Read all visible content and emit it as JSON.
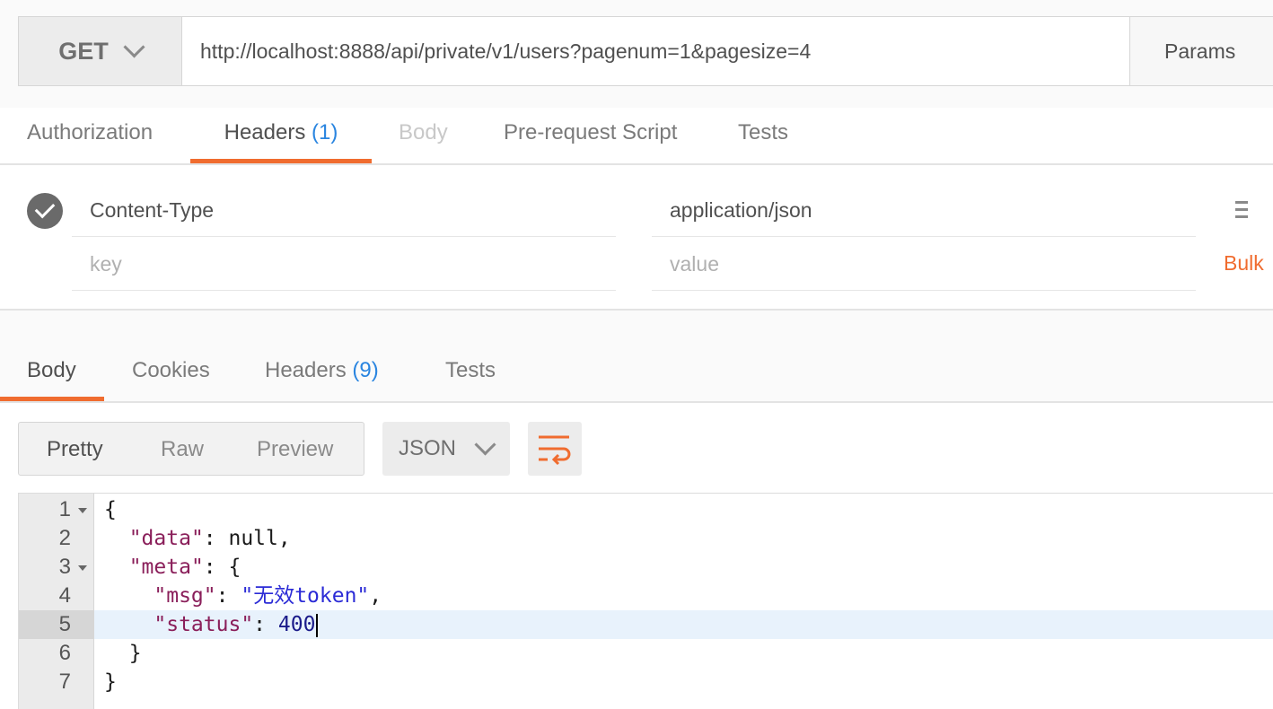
{
  "request": {
    "method": "GET",
    "url": "http://localhost:8888/api/private/v1/users?pagenum=1&pagesize=4",
    "params_label": "Params"
  },
  "request_tabs": [
    {
      "label": "Authorization",
      "count": ""
    },
    {
      "label": "Headers",
      "count": "(1)"
    },
    {
      "label": "Body",
      "count": ""
    },
    {
      "label": "Pre-request Script",
      "count": ""
    },
    {
      "label": "Tests",
      "count": ""
    }
  ],
  "headers": {
    "rows": [
      {
        "key": "Content-Type",
        "value": "application/json",
        "enabled": true
      }
    ],
    "key_placeholder": "key",
    "value_placeholder": "value",
    "bulk_label": "Bulk"
  },
  "response_tabs": [
    {
      "label": "Body",
      "count": ""
    },
    {
      "label": "Cookies",
      "count": ""
    },
    {
      "label": "Headers",
      "count": "(9)"
    },
    {
      "label": "Tests",
      "count": ""
    }
  ],
  "view_modes": [
    "Pretty",
    "Raw",
    "Preview"
  ],
  "active_view_mode": "Pretty",
  "format": "JSON",
  "code_lines": [
    {
      "n": "1",
      "text": "{"
    },
    {
      "n": "2",
      "key": "\"data\"",
      "rest": ": null,"
    },
    {
      "n": "3",
      "key": "\"meta\"",
      "rest": ": {"
    },
    {
      "n": "4",
      "key": "\"msg\"",
      "sep": ": ",
      "str": "\"无效token\"",
      "rest": ","
    },
    {
      "n": "5",
      "key": "\"status\"",
      "sep": ": ",
      "num": "400"
    },
    {
      "n": "6",
      "text": "}"
    },
    {
      "n": "7",
      "text": "}"
    }
  ],
  "colors": {
    "accent": "#f06c2f",
    "count_blue": "#2a85e0",
    "json_key": "#8a1f5a",
    "json_string": "#2b2bd6",
    "json_number": "#1b1b8a",
    "line_highlight": "#e8f2fc"
  }
}
